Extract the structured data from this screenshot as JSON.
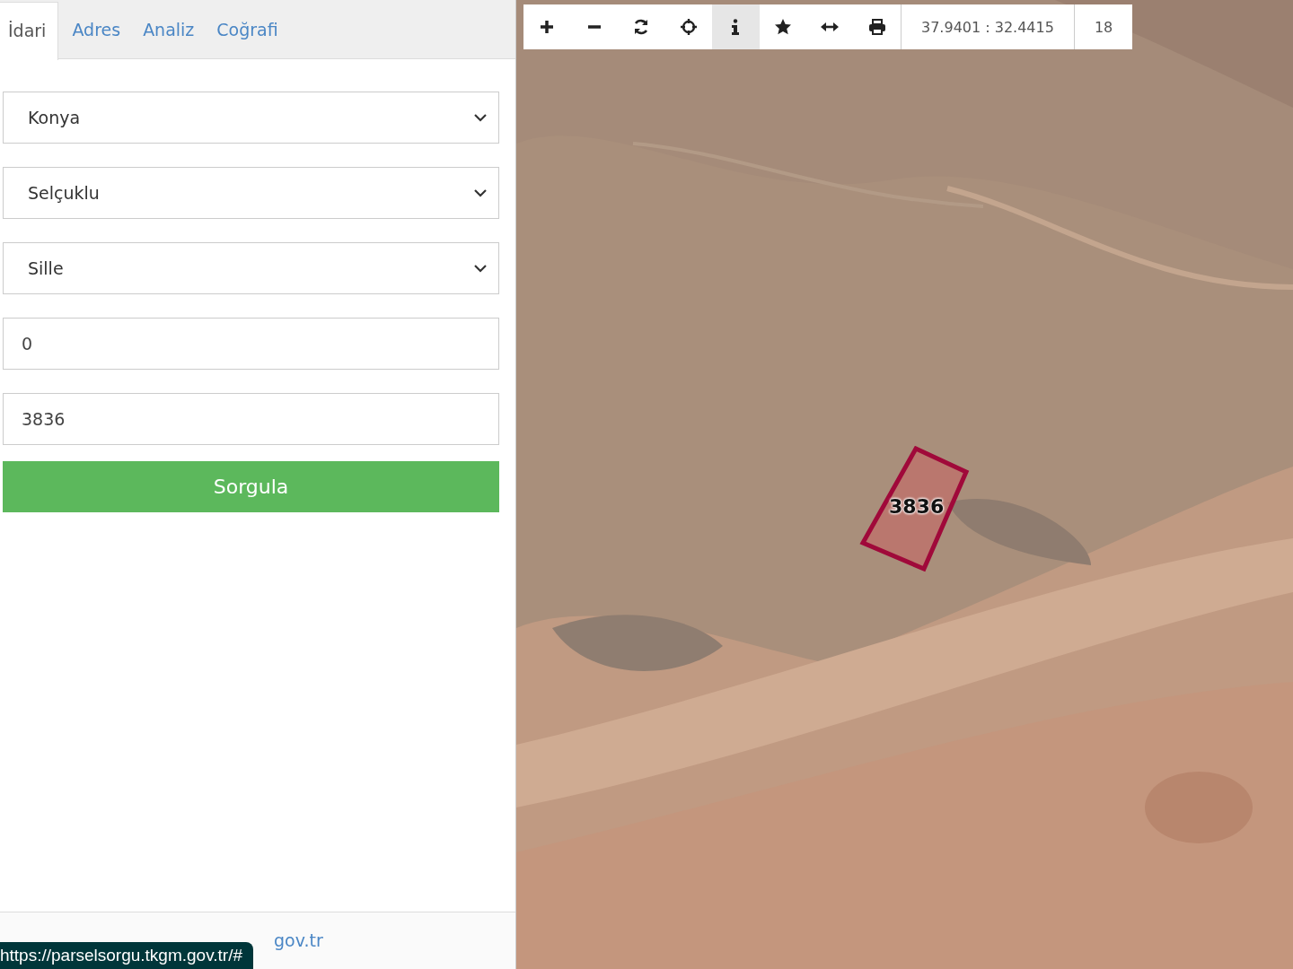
{
  "tabs": [
    {
      "label": "İdari",
      "selected": true
    },
    {
      "label": "Adres",
      "selected": false
    },
    {
      "label": "Analiz",
      "selected": false
    },
    {
      "label": "Coğrafi",
      "selected": false
    }
  ],
  "form": {
    "fields": [
      {
        "kind": "select",
        "value": "Konya"
      },
      {
        "kind": "select",
        "value": "Selçuklu"
      },
      {
        "kind": "select",
        "value": "Sille"
      },
      {
        "kind": "input",
        "value": "0"
      },
      {
        "kind": "input",
        "value": "3836"
      }
    ],
    "submit": "Sorgula"
  },
  "footer": {
    "text": "gov.tr"
  },
  "status_url": "https://parselsorgu.tkgm.gov.tr/#",
  "map": {
    "toolbar": [
      {
        "kind": "zoom-in",
        "selected": false
      },
      {
        "kind": "zoom-out",
        "selected": false
      },
      {
        "kind": "refresh",
        "selected": false
      },
      {
        "kind": "locate",
        "selected": false
      },
      {
        "kind": "info",
        "selected": true
      },
      {
        "kind": "star",
        "selected": false
      },
      {
        "kind": "measure",
        "selected": false
      },
      {
        "kind": "print",
        "selected": false
      }
    ],
    "coordinates": "37.9401 : 32.4415",
    "zoom": "18",
    "parcel": {
      "label": "3836"
    }
  }
}
